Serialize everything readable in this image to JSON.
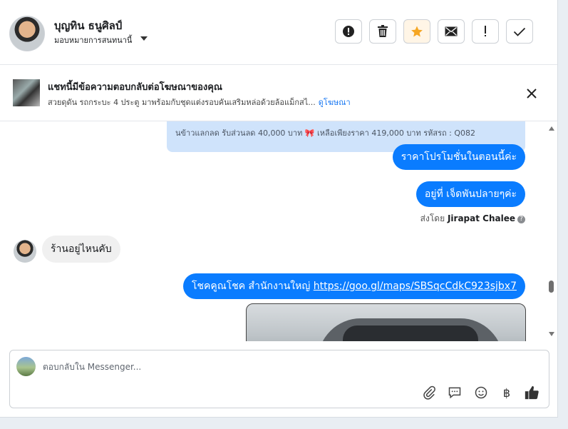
{
  "header": {
    "user_name": "บุญทิน ธนูศิลป์",
    "assign_label": "มอบหมายการสนทนานี้",
    "actions": [
      {
        "name": "alert-button",
        "icon": "exclamation-circle-icon"
      },
      {
        "name": "delete-button",
        "icon": "trash-icon"
      },
      {
        "name": "star-button",
        "icon": "star-icon",
        "color": "#f5a623"
      },
      {
        "name": "mail-button",
        "icon": "envelope-icon"
      },
      {
        "name": "important-button",
        "icon": "exclamation-icon"
      },
      {
        "name": "done-button",
        "icon": "check-icon"
      }
    ]
  },
  "ad": {
    "title": "แชทนี้มีข้อความตอบกลับต่อโฆษณาของคุณ",
    "description": "สวยดุดัน รถกระบะ 4 ประตู มาพร้อมกับชุดแต่งรอบคันเสริมหล่อด้วยล้อแม็กสไ...",
    "link": "ดูโฆษณา"
  },
  "conversation": {
    "quoted_text": "นข้าวแลกลด รับส่วนลด 40,000 บาท 🎀 เหลือเพียงราคา 419,000 บาท รหัสรถ : Q082",
    "messages": [
      {
        "from": "page",
        "text": "ราคาโปรโมชั่นในตอนนี้ค่ะ"
      },
      {
        "from": "page",
        "text": "อยู่ที่ เจ็ดพันปลายๆค่ะ"
      },
      {
        "from": "customer",
        "text": "ร้านอยู่ไหนคับ"
      },
      {
        "from": "page",
        "text": "โชคคูณโชค สำนักงานใหญ่ ",
        "link": "https://goo.gl/maps/SBSqcCdkC923sjbx7"
      }
    ],
    "sent_by_prefix": "ส่งโดย",
    "sent_by_name": "Jirapat Chalee"
  },
  "composer": {
    "placeholder": "ตอบกลับใน Messenger...",
    "icons": [
      "paperclip-icon",
      "comment-icon",
      "smiley-icon",
      "baht-icon",
      "thumbs-up-icon"
    ],
    "baht_symbol": "฿"
  },
  "colors": {
    "accent": "#0a7cff",
    "link": "#1877f2",
    "star": "#f5a623"
  }
}
